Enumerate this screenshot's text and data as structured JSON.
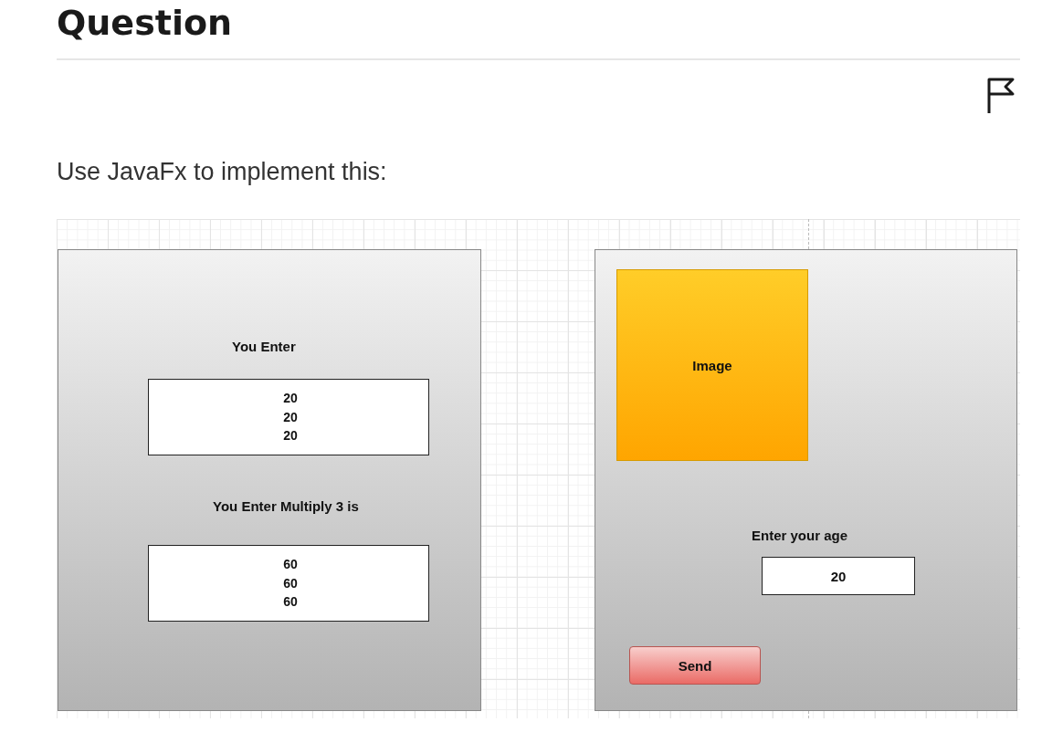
{
  "title": "Question",
  "prompt": "Use JavaFx to implement this:",
  "mockup": {
    "left_panel": {
      "label_1": "You Enter",
      "output_1": [
        "20",
        "20",
        "20"
      ],
      "label_2": "You Enter Multiply 3 is",
      "output_2": [
        "60",
        "60",
        "60"
      ]
    },
    "right_panel": {
      "image_label": "Image",
      "age_label": "Enter your age",
      "age_value": "20",
      "button": "Send"
    }
  }
}
